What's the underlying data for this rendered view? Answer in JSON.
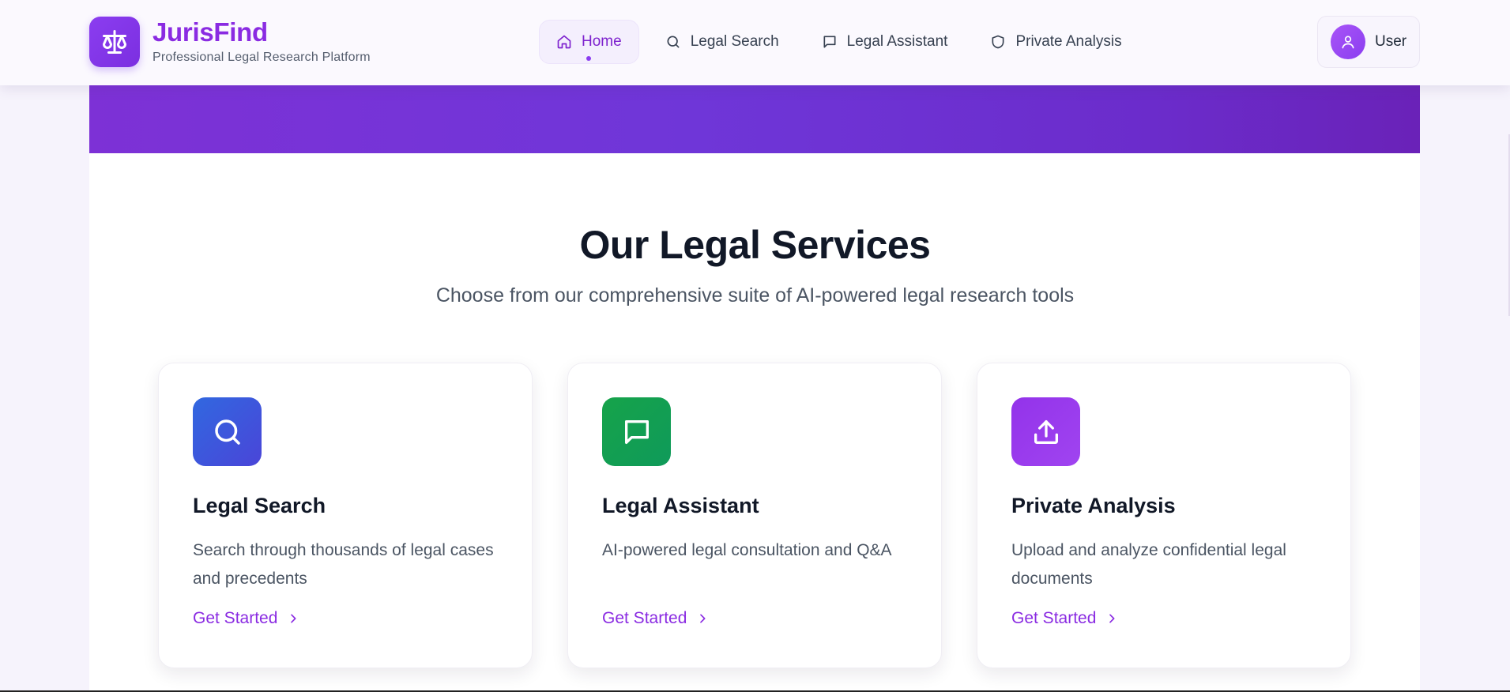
{
  "header": {
    "brand_name": "JurisFind",
    "brand_subtitle": "Professional Legal Research Platform",
    "logo_icon": "scale-icon",
    "nav": [
      {
        "label": "Home",
        "icon": "home-icon",
        "active": true
      },
      {
        "label": "Legal Search",
        "icon": "search-icon",
        "active": false
      },
      {
        "label": "Legal Assistant",
        "icon": "chat-icon",
        "active": false
      },
      {
        "label": "Private Analysis",
        "icon": "shield-icon",
        "active": false
      }
    ],
    "user_label": "User",
    "user_icon": "user-icon"
  },
  "main": {
    "title": "Our Legal Services",
    "subtitle": "Choose from our comprehensive suite of AI-powered legal research tools",
    "cards": [
      {
        "title": "Legal Search",
        "description": "Search through thousands of legal cases and precedents",
        "cta": "Get Started",
        "icon": "search-icon",
        "color": "#3b5be6"
      },
      {
        "title": "Legal Assistant",
        "description": "AI-powered legal consultation and Q&A",
        "cta": "Get Started",
        "icon": "chat-icon",
        "color": "#16a34a"
      },
      {
        "title": "Private Analysis",
        "description": "Upload and analyze confidential legal documents",
        "cta": "Get Started",
        "icon": "upload-icon",
        "color": "#9333ea"
      }
    ]
  },
  "colors": {
    "accent": "#8a2be2",
    "hero_gradient_start": "#7d31d6",
    "hero_gradient_end": "#6a22b8"
  }
}
